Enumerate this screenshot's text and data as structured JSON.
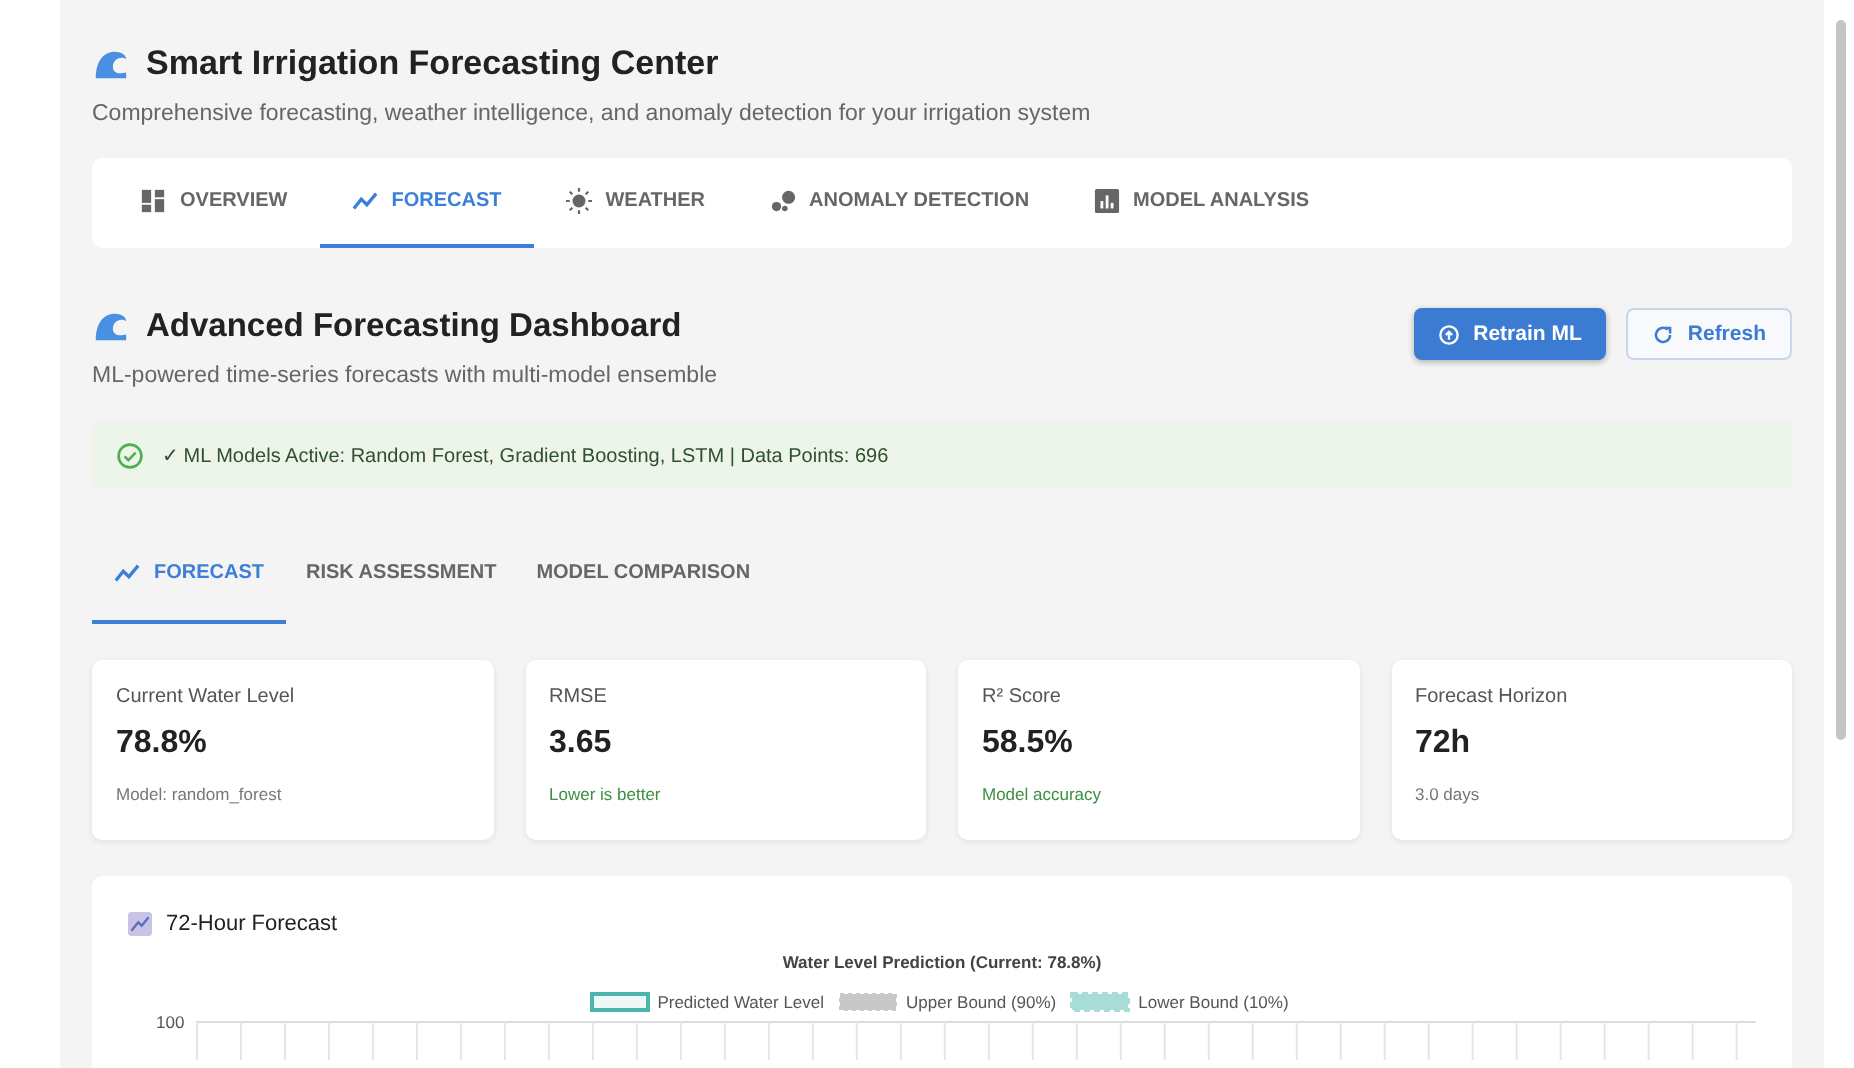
{
  "header": {
    "title": "Smart Irrigation Forecasting Center",
    "subtitle": "Comprehensive forecasting, weather intelligence, and anomaly detection for your irrigation system"
  },
  "tabs": [
    {
      "label": "OVERVIEW",
      "kind": "dashboard",
      "selected": false
    },
    {
      "label": "FORECAST",
      "kind": "trend",
      "selected": true
    },
    {
      "label": "WEATHER",
      "kind": "sun",
      "selected": false
    },
    {
      "label": "ANOMALY DETECTION",
      "kind": "dots",
      "selected": false
    },
    {
      "label": "MODEL ANALYSIS",
      "kind": "bars",
      "selected": false
    }
  ],
  "section": {
    "title": "Advanced Forecasting Dashboard",
    "subtitle": "ML-powered time-series forecasts with multi-model ensemble",
    "buttons": [
      {
        "label": "Retrain ML",
        "kind": "primary"
      },
      {
        "label": "Refresh",
        "kind": "outline"
      }
    ]
  },
  "alert": {
    "text": "✓ ML Models Active: Random Forest, Gradient Boosting, LSTM | Data Points: 696"
  },
  "subtabs": [
    {
      "label": "FORECAST",
      "kind": "trend",
      "selected": true
    },
    {
      "label": "RISK ASSESSMENT",
      "kind": "plain",
      "selected": false
    },
    {
      "label": "MODEL COMPARISON",
      "kind": "plain",
      "selected": false
    }
  ],
  "cards": [
    {
      "label": "Current Water Level",
      "value": "78.8%",
      "note": "Model: random_forest",
      "kind": "neutral"
    },
    {
      "label": "RMSE",
      "value": "3.65",
      "note": "Lower is better",
      "kind": "positive"
    },
    {
      "label": "R² Score",
      "value": "58.5%",
      "note": "Model accuracy",
      "kind": "positive"
    },
    {
      "label": "Forecast Horizon",
      "value": "72h",
      "note": "3.0 days",
      "kind": "neutral"
    }
  ],
  "forecast": {
    "title": "72-Hour Forecast",
    "chart_title": "Water Level Prediction (Current: 78.8%)",
    "legend": [
      {
        "label": "Predicted Water Level",
        "color": "#4db6ac",
        "kind": "solid"
      },
      {
        "label": "Upper Bound (90%)",
        "color": "#c8c8c8",
        "kind": "hatched"
      },
      {
        "label": "Lower Bound (10%)",
        "color": "#a8dcd6",
        "kind": "dashed"
      }
    ],
    "y_tick": "100"
  }
}
